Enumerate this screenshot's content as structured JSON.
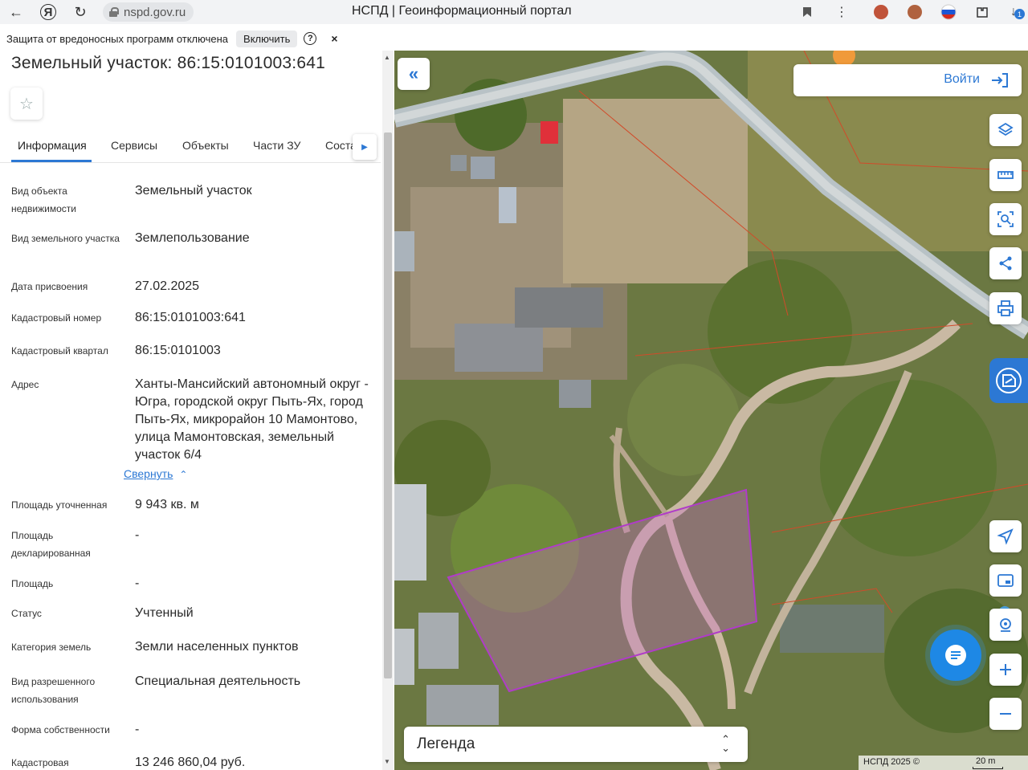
{
  "browser": {
    "url": "nspd.gov.ru",
    "title": "НСПД | Геоинформационный портал",
    "download_badge": "1"
  },
  "notice": {
    "text": "Защита от вредоносных программ отключена",
    "enable_label": "Включить",
    "help_label": "?",
    "close_label": "×"
  },
  "panel": {
    "title": "Земельный участок: 86:15:0101003:641",
    "tabs": [
      "Информация",
      "Сервисы",
      "Объекты",
      "Части ЗУ",
      "Соста"
    ],
    "fields": [
      {
        "label": "Вид объекта недвижимости",
        "value": "Земельный участок"
      },
      {
        "label": "Вид земельного участка",
        "value": "Землепользование"
      },
      {
        "label": "Дата присвоения",
        "value": "27.02.2025"
      },
      {
        "label": "Кадастровый номер",
        "value": "86:15:0101003:641"
      },
      {
        "label": "Кадастровый квартал",
        "value": "86:15:0101003"
      },
      {
        "label": "Адрес",
        "value": "Ханты-Мансийский автономный округ - Югра, городской округ Пыть-Ях, город Пыть-Ях, микрорайон 10 Мамонтово, улица Мамонтовская, земельный участок 6/4"
      },
      {
        "label": "Площадь уточненная",
        "value": "9 943 кв. м"
      },
      {
        "label": "Площадь декларированная",
        "value": "-"
      },
      {
        "label": "Площадь",
        "value": "-"
      },
      {
        "label": "Статус",
        "value": "Учтенный"
      },
      {
        "label": "Категория земель",
        "value": "Земли населенных пунктов"
      },
      {
        "label": "Вид разрешенного использования",
        "value": "Специальная деятельность"
      },
      {
        "label": "Форма собственности",
        "value": "-"
      },
      {
        "label": "Кадастровая",
        "value": "13 246 860,04 руб."
      }
    ],
    "collapse_label": "Свернуть"
  },
  "map": {
    "login_label": "Войти",
    "legend_label": "Легенда",
    "copyright": "НСПД 2025 ©",
    "scale_label": "20 m",
    "parcel_color": "#b03cc8",
    "accent_color": "#2c78d4"
  },
  "icons": [
    "arrow-left-icon",
    "yandex-icon",
    "reload-icon",
    "lock-icon",
    "bookmark-icon",
    "menu-dots-icon",
    "extension-icon",
    "flag-icon",
    "download-icon",
    "star-icon",
    "chevron-right-icon",
    "double-chevron-left-icon",
    "login-icon",
    "layers-icon",
    "ruler-icon",
    "area-search-icon",
    "share-icon",
    "print-icon",
    "navigation-icon",
    "minimap-icon",
    "location-icon",
    "zoom-in-icon",
    "zoom-out-icon",
    "chat-icon"
  ]
}
